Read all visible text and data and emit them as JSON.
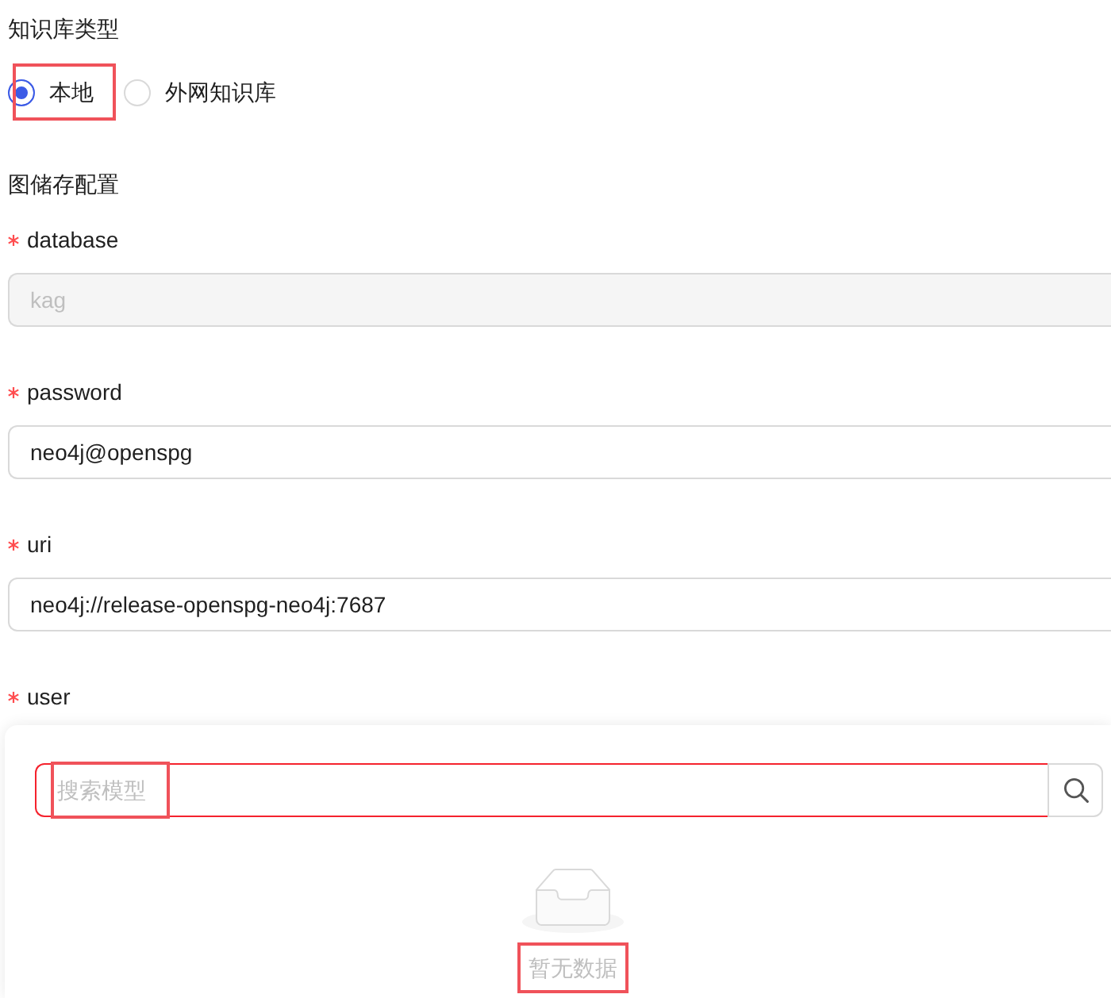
{
  "knowledge_base_type": {
    "label": "知识库类型",
    "options": [
      {
        "label": "本地",
        "selected": true,
        "highlighted": true
      },
      {
        "label": "外网知识库",
        "selected": false,
        "highlighted": false
      }
    ]
  },
  "graph_storage": {
    "title": "图储存配置",
    "fields": [
      {
        "label": "database",
        "required": true,
        "value": "kag",
        "disabled": true
      },
      {
        "label": "password",
        "required": true,
        "value": "neo4j@openspg",
        "disabled": false
      },
      {
        "label": "uri",
        "required": true,
        "value": "neo4j://release-openspg-neo4j:7687",
        "disabled": false
      },
      {
        "label": "user",
        "required": true
      }
    ]
  },
  "model_dropdown": {
    "search": {
      "placeholder": "搜索模型",
      "error": true,
      "highlighted": true
    },
    "empty_state": {
      "text": "暂无数据",
      "highlighted": true
    }
  }
}
